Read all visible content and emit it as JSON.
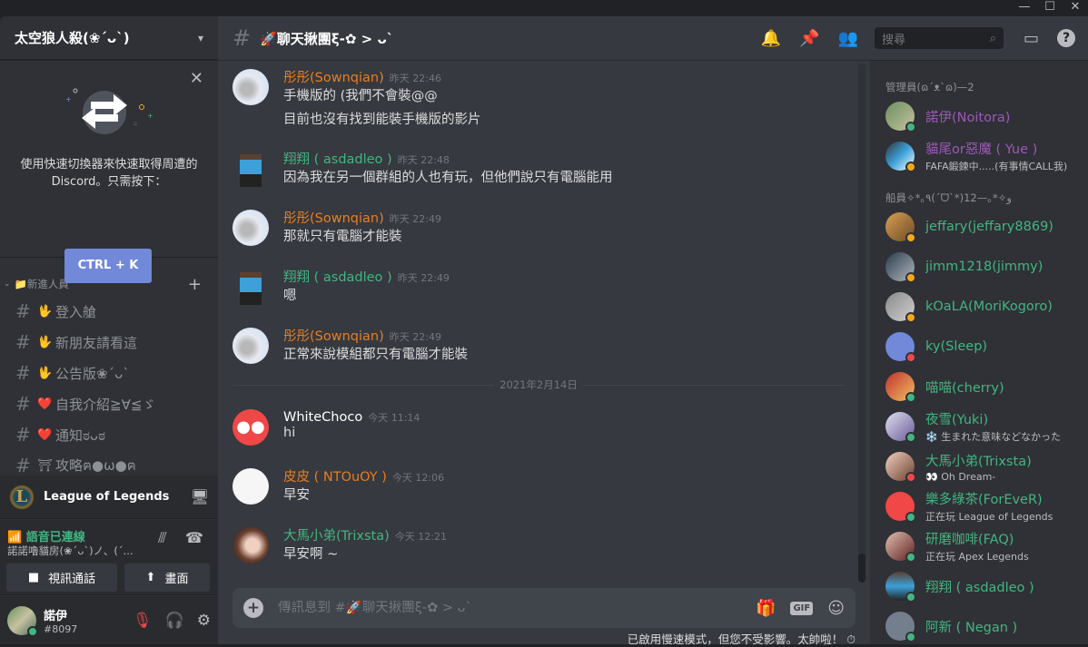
{
  "window": {
    "minimize": "—",
    "maximize": "☐",
    "close": "✕"
  },
  "server": {
    "name": "太空狼人殺(❀ˊᴗˋ)",
    "chevron": "⌄"
  },
  "quick_switcher": {
    "close": "✕",
    "text": "使用快速切換器來快速取得周遭的 Discord。只需按下：",
    "button": "CTRL + K"
  },
  "category": {
    "name": "📁新進人員",
    "collapse": "⌄",
    "add": "+"
  },
  "channels": [
    {
      "emoji": "🖖",
      "name": "登入艙"
    },
    {
      "emoji": "🖖",
      "name": "新朋友請看這"
    },
    {
      "emoji": "🖖",
      "name": "公告版❀ˊᴗˋ"
    },
    {
      "emoji": "❤️",
      "name": "自我介紹≧∀≦ゞ"
    },
    {
      "emoji": "❤️",
      "name": "通知ಠᴗಠ"
    },
    {
      "emoji": "⛩",
      "name": "攻略ฅ●ω●ฅ"
    }
  ],
  "game_activity": {
    "logo": "L",
    "name": "League of Legends"
  },
  "voice": {
    "status": "語音已連線",
    "room": "諾諾嚕貓房(❀ˊᴗˋ)ノ、(ˊ...",
    "video_button": "視訊通話",
    "screen_button": "畫面"
  },
  "user": {
    "name": "諾伊",
    "tag": "#8097",
    "status_color": "#43b581"
  },
  "channel_header": {
    "hash": "#",
    "title": "🚀聊天揪團ξ-✿ > ᴗˋ",
    "search_placeholder": "搜尋"
  },
  "messages": [
    {
      "author": "彤彤(Sownqian)",
      "color": "#e67e22",
      "time": "昨天 22:46",
      "lines": [
        "手機版的 (我們不會裝@@",
        "目前也沒有找到能裝手機版的影片"
      ],
      "avatar": "light"
    },
    {
      "author": "翔翔 ( asdadleo )",
      "color": "#43b581",
      "time": "昨天 22:48",
      "lines": [
        "因為我在另一個群組的人也有玩，但他們說只有電腦能用"
      ],
      "avatar": "pixel"
    },
    {
      "author": "彤彤(Sownqian)",
      "color": "#e67e22",
      "time": "昨天 22:49",
      "lines": [
        "那就只有電腦才能裝"
      ],
      "avatar": "light"
    },
    {
      "author": "翔翔 ( asdadleo )",
      "color": "#43b581",
      "time": "昨天 22:49",
      "lines": [
        "嗯"
      ],
      "avatar": "pixel"
    },
    {
      "author": "彤彤(Sownqian)",
      "color": "#e67e22",
      "time": "昨天 22:49",
      "lines": [
        "正常來說模組都只有電腦才能裝"
      ],
      "avatar": "light"
    },
    {
      "author": "WhiteChoco",
      "color": "#ffffff",
      "time": "今天 11:14",
      "lines": [
        "hi"
      ],
      "avatar": "discord-red"
    },
    {
      "author": "皮皮 ( NTOuOY )",
      "color": "#e67e22",
      "time": "今天 12:06",
      "lines": [
        "早安"
      ],
      "avatar": "white"
    },
    {
      "author": "大馬小弟(Trixsta)",
      "color": "#43b581",
      "time": "今天 12:21",
      "lines": [
        "早安啊 ~"
      ],
      "avatar": "photo"
    }
  ],
  "date_divider": "2021年2月14日",
  "composer": {
    "placeholder": "傳訊息到 #🚀聊天揪團ξ-✿ > ᴗˋ",
    "gif": "GIF"
  },
  "slowmode_notice": "已啟用慢速模式，但您不受影響。太帥啦！",
  "member_groups": [
    {
      "title": "管理員(ɷˊᴥˋɷ)—2",
      "members": [
        {
          "name": "諾伊(Noitora)",
          "color": "#9b59b6",
          "status": "online",
          "sub": ""
        },
        {
          "name": "貓尾or惡魔 ( Yue )",
          "color": "#9b59b6",
          "status": "idle",
          "sub": "FAFA鍛鍊中.....(有事情CALL我)"
        }
      ]
    },
    {
      "title": "船員✧*｡٩(ˊᗜˋ*)12—｡*✧ﻭ",
      "members": [
        {
          "name": "jeffary(jeffary8869)",
          "color": "#43b581",
          "status": "idle",
          "sub": ""
        },
        {
          "name": "jimm1218(jimmy)",
          "color": "#43b581",
          "status": "idle",
          "sub": ""
        },
        {
          "name": "kOaLA(MoriKogoro)",
          "color": "#43b581",
          "status": "idle",
          "sub": ""
        },
        {
          "name": "ky(Sleep)",
          "color": "#43b581",
          "status": "dnd",
          "sub": ""
        },
        {
          "name": "喵喵(cherry)",
          "color": "#43b581",
          "status": "online",
          "sub": ""
        },
        {
          "name": "夜雪(Yuki)",
          "color": "#43b581",
          "status": "online",
          "sub": "❄️ 生まれた意味などなかった"
        },
        {
          "name": "大馬小弟(Trixsta)",
          "color": "#43b581",
          "status": "dnd",
          "sub": "👀 Oh Dream-"
        },
        {
          "name": "樂多綠茶(ForEveR)",
          "color": "#43b581",
          "status": "online",
          "sub": "正在玩 League of Legends"
        },
        {
          "name": "研磨咖啡(FAQ)",
          "color": "#43b581",
          "status": "online",
          "sub": "正在玩 Apex Legends"
        },
        {
          "name": "翔翔 ( asdadleo )",
          "color": "#43b581",
          "status": "mobile",
          "sub": ""
        },
        {
          "name": "阿新 ( Negan )",
          "color": "#43b581",
          "status": "online",
          "sub": ""
        }
      ]
    }
  ],
  "colors": {
    "accent": "#7289da",
    "online": "#43b581",
    "idle": "#faa61a",
    "dnd": "#f04747"
  }
}
